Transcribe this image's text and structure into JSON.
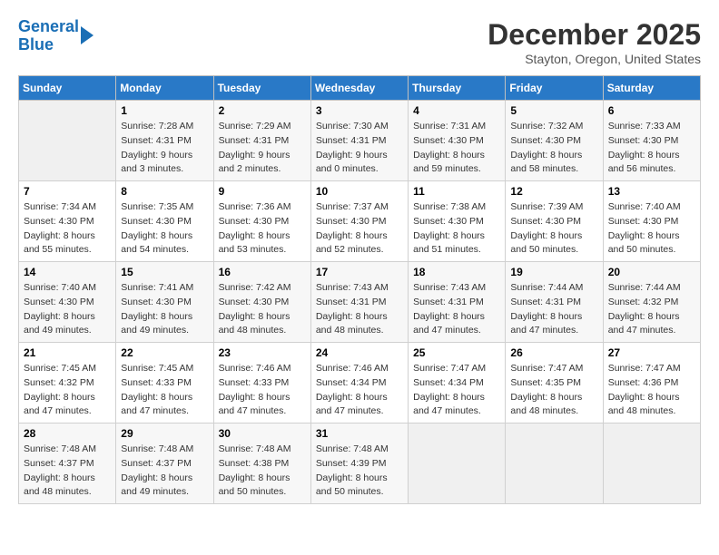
{
  "header": {
    "logo_line1": "General",
    "logo_line2": "Blue",
    "month_title": "December 2025",
    "location": "Stayton, Oregon, United States"
  },
  "weekdays": [
    "Sunday",
    "Monday",
    "Tuesday",
    "Wednesday",
    "Thursday",
    "Friday",
    "Saturday"
  ],
  "weeks": [
    [
      {
        "day": "",
        "sunrise": "",
        "sunset": "",
        "daylight": ""
      },
      {
        "day": "1",
        "sunrise": "7:28 AM",
        "sunset": "4:31 PM",
        "daylight": "9 hours and 3 minutes."
      },
      {
        "day": "2",
        "sunrise": "7:29 AM",
        "sunset": "4:31 PM",
        "daylight": "9 hours and 2 minutes."
      },
      {
        "day": "3",
        "sunrise": "7:30 AM",
        "sunset": "4:31 PM",
        "daylight": "9 hours and 0 minutes."
      },
      {
        "day": "4",
        "sunrise": "7:31 AM",
        "sunset": "4:30 PM",
        "daylight": "8 hours and 59 minutes."
      },
      {
        "day": "5",
        "sunrise": "7:32 AM",
        "sunset": "4:30 PM",
        "daylight": "8 hours and 58 minutes."
      },
      {
        "day": "6",
        "sunrise": "7:33 AM",
        "sunset": "4:30 PM",
        "daylight": "8 hours and 56 minutes."
      }
    ],
    [
      {
        "day": "7",
        "sunrise": "7:34 AM",
        "sunset": "4:30 PM",
        "daylight": "8 hours and 55 minutes."
      },
      {
        "day": "8",
        "sunrise": "7:35 AM",
        "sunset": "4:30 PM",
        "daylight": "8 hours and 54 minutes."
      },
      {
        "day": "9",
        "sunrise": "7:36 AM",
        "sunset": "4:30 PM",
        "daylight": "8 hours and 53 minutes."
      },
      {
        "day": "10",
        "sunrise": "7:37 AM",
        "sunset": "4:30 PM",
        "daylight": "8 hours and 52 minutes."
      },
      {
        "day": "11",
        "sunrise": "7:38 AM",
        "sunset": "4:30 PM",
        "daylight": "8 hours and 51 minutes."
      },
      {
        "day": "12",
        "sunrise": "7:39 AM",
        "sunset": "4:30 PM",
        "daylight": "8 hours and 50 minutes."
      },
      {
        "day": "13",
        "sunrise": "7:40 AM",
        "sunset": "4:30 PM",
        "daylight": "8 hours and 50 minutes."
      }
    ],
    [
      {
        "day": "14",
        "sunrise": "7:40 AM",
        "sunset": "4:30 PM",
        "daylight": "8 hours and 49 minutes."
      },
      {
        "day": "15",
        "sunrise": "7:41 AM",
        "sunset": "4:30 PM",
        "daylight": "8 hours and 49 minutes."
      },
      {
        "day": "16",
        "sunrise": "7:42 AM",
        "sunset": "4:30 PM",
        "daylight": "8 hours and 48 minutes."
      },
      {
        "day": "17",
        "sunrise": "7:43 AM",
        "sunset": "4:31 PM",
        "daylight": "8 hours and 48 minutes."
      },
      {
        "day": "18",
        "sunrise": "7:43 AM",
        "sunset": "4:31 PM",
        "daylight": "8 hours and 47 minutes."
      },
      {
        "day": "19",
        "sunrise": "7:44 AM",
        "sunset": "4:31 PM",
        "daylight": "8 hours and 47 minutes."
      },
      {
        "day": "20",
        "sunrise": "7:44 AM",
        "sunset": "4:32 PM",
        "daylight": "8 hours and 47 minutes."
      }
    ],
    [
      {
        "day": "21",
        "sunrise": "7:45 AM",
        "sunset": "4:32 PM",
        "daylight": "8 hours and 47 minutes."
      },
      {
        "day": "22",
        "sunrise": "7:45 AM",
        "sunset": "4:33 PM",
        "daylight": "8 hours and 47 minutes."
      },
      {
        "day": "23",
        "sunrise": "7:46 AM",
        "sunset": "4:33 PM",
        "daylight": "8 hours and 47 minutes."
      },
      {
        "day": "24",
        "sunrise": "7:46 AM",
        "sunset": "4:34 PM",
        "daylight": "8 hours and 47 minutes."
      },
      {
        "day": "25",
        "sunrise": "7:47 AM",
        "sunset": "4:34 PM",
        "daylight": "8 hours and 47 minutes."
      },
      {
        "day": "26",
        "sunrise": "7:47 AM",
        "sunset": "4:35 PM",
        "daylight": "8 hours and 48 minutes."
      },
      {
        "day": "27",
        "sunrise": "7:47 AM",
        "sunset": "4:36 PM",
        "daylight": "8 hours and 48 minutes."
      }
    ],
    [
      {
        "day": "28",
        "sunrise": "7:48 AM",
        "sunset": "4:37 PM",
        "daylight": "8 hours and 48 minutes."
      },
      {
        "day": "29",
        "sunrise": "7:48 AM",
        "sunset": "4:37 PM",
        "daylight": "8 hours and 49 minutes."
      },
      {
        "day": "30",
        "sunrise": "7:48 AM",
        "sunset": "4:38 PM",
        "daylight": "8 hours and 50 minutes."
      },
      {
        "day": "31",
        "sunrise": "7:48 AM",
        "sunset": "4:39 PM",
        "daylight": "8 hours and 50 minutes."
      },
      {
        "day": "",
        "sunrise": "",
        "sunset": "",
        "daylight": ""
      },
      {
        "day": "",
        "sunrise": "",
        "sunset": "",
        "daylight": ""
      },
      {
        "day": "",
        "sunrise": "",
        "sunset": "",
        "daylight": ""
      }
    ]
  ]
}
